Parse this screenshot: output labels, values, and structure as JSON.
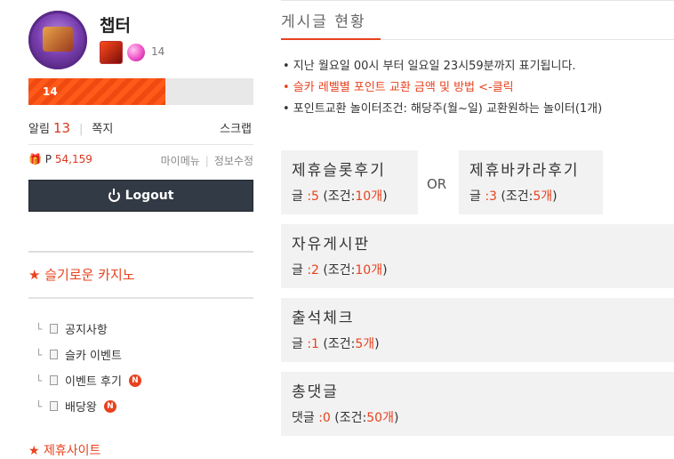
{
  "profile": {
    "nickname": "챕터",
    "level": "14",
    "exp_level_text": "14",
    "exp_fraction": 0.61
  },
  "user_menu": {
    "alarm_label": "알림",
    "alarm_count": "13",
    "message_label": "쪽지",
    "scrap_label": "스크랩",
    "point_label": "P",
    "point_value": "54,159",
    "mymenu_label": "마이메뉴",
    "edit_info_label": "정보수정",
    "logout_label": "Logout"
  },
  "sidebar": {
    "category_title": "★ 슬기로운 카지노",
    "boards": [
      {
        "label": "공지사항",
        "is_new": false
      },
      {
        "label": "슬카 이벤트",
        "is_new": false
      },
      {
        "label": "이벤트 후기",
        "is_new": true
      },
      {
        "label": "배당왕",
        "is_new": true
      }
    ],
    "new_badge": "N",
    "next_section": "★ 제휴사이트"
  },
  "main": {
    "title": "게시글 현황",
    "notices": [
      "• 지난 월요일 00시 부터 일요일 23시59분까지 표기됩니다.",
      "• 슬카 레벨별 포인트 교환 금액 및 방법 <-클릭",
      "• 포인트교환 놀이터조건: 해당주(월~일) 교환원하는 놀이터(1개)"
    ],
    "or_label": "OR",
    "boxes": [
      {
        "title": "제휴슬롯후기",
        "prefix": "글 ",
        "count": ":5",
        "cond_prefix": "(조건:",
        "cond_value": "10개",
        "cond_suffix": ")"
      },
      {
        "title": "제휴바카라후기",
        "prefix": "글 ",
        "count": ":3",
        "cond_prefix": "(조건:",
        "cond_value": "5개",
        "cond_suffix": ")"
      },
      {
        "title": "자유게시판",
        "prefix": "글 ",
        "count": ":2",
        "cond_prefix": "(조건:",
        "cond_value": "10개",
        "cond_suffix": ")"
      },
      {
        "title": "출석체크",
        "prefix": "글 ",
        "count": ":1",
        "cond_prefix": "(조건:",
        "cond_value": "5개",
        "cond_suffix": ")"
      },
      {
        "title": "총댓글",
        "prefix": "댓글 ",
        "count": ":0",
        "cond_prefix": "(조건:",
        "cond_value": "50개",
        "cond_suffix": ")"
      }
    ]
  },
  "colors": {
    "accent": "#e8421e",
    "logout_bg": "#323a45",
    "box_bg": "#f2f2f2"
  }
}
